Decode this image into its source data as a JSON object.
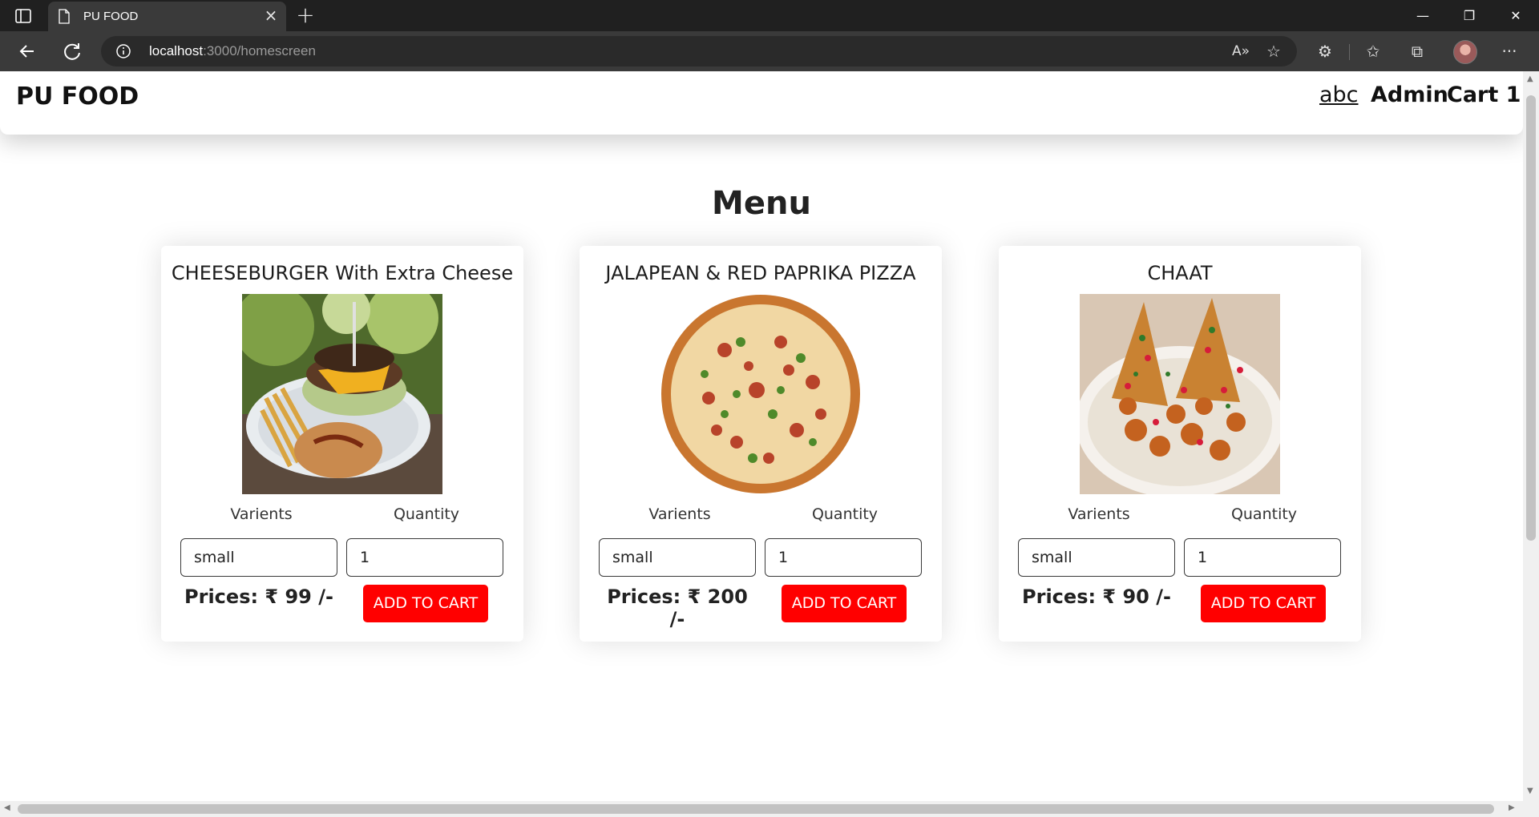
{
  "browser": {
    "tab_title": "PU FOOD",
    "url_host": "localhost",
    "url_path": ":3000/homescreen"
  },
  "navbar": {
    "brand": "PU FOOD",
    "user": "abc",
    "admin": "Admin",
    "cart": "Cart 1"
  },
  "menu": {
    "title": "Menu",
    "varients_label": "Varients",
    "quantity_label": "Quantity",
    "add_to_cart_label": "ADD TO CART",
    "items": [
      {
        "name": "CHEESEBURGER With Extra Cheese",
        "varient": "small",
        "quantity": "1",
        "price": "Prices: ₹ 99 /-"
      },
      {
        "name": "JALAPEAN & RED PAPRIKA PIZZA",
        "varient": "small",
        "quantity": "1",
        "price": "Prices: ₹ 200 /-"
      },
      {
        "name": "CHAAT",
        "varient": "small",
        "quantity": "1",
        "price": "Prices: ₹ 90 /-"
      }
    ]
  },
  "colors": {
    "accent_button": "#ff0000",
    "browser_frame": "#202020"
  },
  "icons": [
    "tab-actions-icon",
    "page-icon",
    "close-icon",
    "plus-icon",
    "minimize-icon",
    "restore-icon",
    "back-icon",
    "refresh-icon",
    "info-icon",
    "read-aloud-icon",
    "add-favorite-icon",
    "extensions-icon",
    "favorites-icon",
    "collections-icon",
    "profile-avatar",
    "more-icon"
  ]
}
